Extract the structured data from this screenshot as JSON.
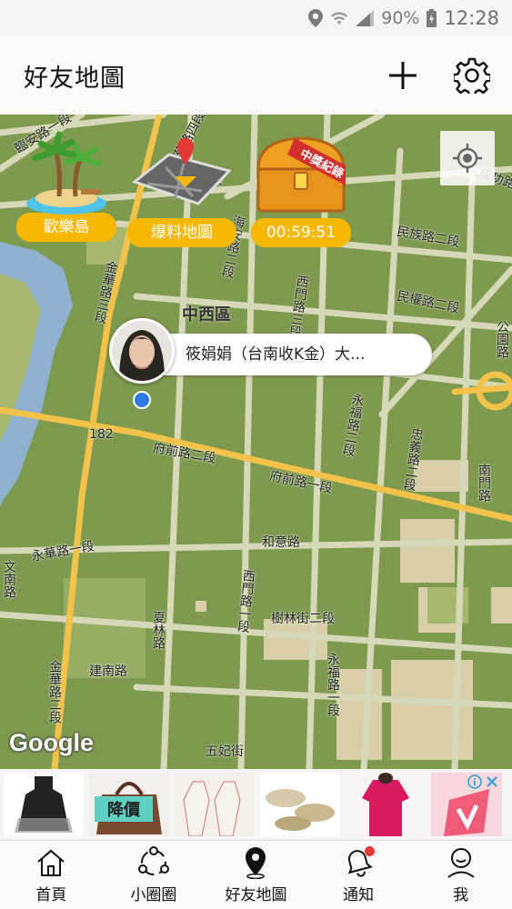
{
  "status_bar": {
    "battery": "90%",
    "time": "12:28"
  },
  "header": {
    "title": "好友地圖"
  },
  "map": {
    "district": "中西區",
    "streets": [
      "臨安路一段",
      "金華路四段",
      "民權路三段",
      "海安路二段",
      "民族路二段",
      "民權路二段",
      "成功路",
      "公園路",
      "西門路三段",
      "永福路二段",
      "府前路二段",
      "府前路一段",
      "忠義路二段",
      "南門路",
      "和意路",
      "永華路一段",
      "西門路一段",
      "樹林街二段",
      "夏林路",
      "建南路",
      "永福路一段",
      "五妃街",
      "金華路三段",
      "金華路二段",
      "文南路",
      "182"
    ],
    "google": "Google"
  },
  "features": [
    {
      "name": "island",
      "label": "歡樂島"
    },
    {
      "name": "report-map",
      "label": "爆料地圖"
    },
    {
      "name": "treasure",
      "label": "00:59:51",
      "chest_text": "中獎紀錄"
    }
  ],
  "friend": {
    "name": "筱娟娟（台南收K金）大..."
  },
  "ad": {
    "badge": "降價"
  },
  "nav": [
    {
      "label": "首頁"
    },
    {
      "label": "小圈圈"
    },
    {
      "label": "好友地圖"
    },
    {
      "label": "通知"
    },
    {
      "label": "我"
    }
  ],
  "colors": {
    "accent": "#f6b800",
    "map_green": "#7d9a4f",
    "road": "#f2c24a",
    "user_dot": "#2f7be6"
  }
}
